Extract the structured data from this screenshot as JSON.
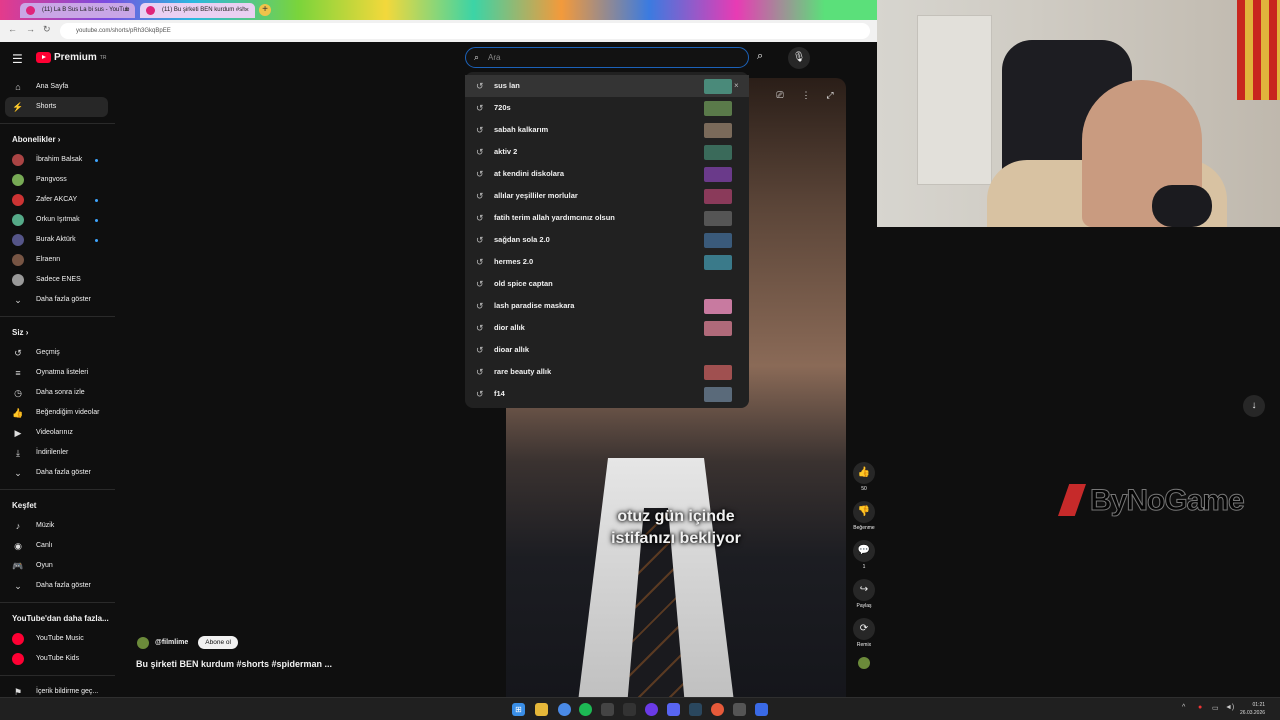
{
  "browser": {
    "tabs": [
      {
        "label": "(11) La B Sus La bi sus - YouTub"
      },
      {
        "label": "(11) Bu şirketi BEN kurdum #sh"
      }
    ],
    "tab_close": "×",
    "new_tab": "+",
    "url": "youtube.com/shorts/pRh3GkqBpEE"
  },
  "header": {
    "logo_text": "Premium",
    "logo_sup": "TR",
    "search_placeholder": "Ara"
  },
  "sidebar": {
    "main": [
      {
        "label": "Ana Sayfa",
        "icon": "home-icon"
      },
      {
        "label": "Shorts",
        "icon": "shorts-icon"
      }
    ],
    "subs_head": "Abonelikler",
    "subs": [
      {
        "label": "İbrahim Balsak"
      },
      {
        "label": "Pangvoss"
      },
      {
        "label": "Zafer AKCAY"
      },
      {
        "label": "Orkun Işıtmak"
      },
      {
        "label": "Burak Aktürk"
      },
      {
        "label": "Elraenn"
      },
      {
        "label": "Sadece ENES"
      }
    ],
    "more1": "Daha fazla göster",
    "you_head": "Siz",
    "you": [
      {
        "label": "Geçmiş",
        "icon": "history-icon"
      },
      {
        "label": "Oynatma listeleri",
        "icon": "playlist-icon"
      },
      {
        "label": "Daha sonra izle",
        "icon": "clock-icon"
      },
      {
        "label": "Beğendiğim videolar",
        "icon": "like-icon"
      },
      {
        "label": "Videolarınız",
        "icon": "video-icon"
      },
      {
        "label": "İndirilenler",
        "icon": "download-icon"
      }
    ],
    "more2": "Daha fazla göster",
    "explore_head": "Keşfet",
    "explore": [
      {
        "label": "Müzik",
        "icon": "music-icon"
      },
      {
        "label": "Canlı",
        "icon": "live-icon"
      },
      {
        "label": "Oyun",
        "icon": "gaming-icon"
      }
    ],
    "more3": "Daha fazla göster",
    "more_yt_head": "YouTube'dan daha fazla...",
    "more_yt": [
      {
        "label": "YouTube Music"
      },
      {
        "label": "YouTube Kids"
      }
    ],
    "report": "İçerik bildirme geç..."
  },
  "suggestions": [
    {
      "text": "sus lan",
      "thumb": "#4a8a7a"
    },
    {
      "text": "720s",
      "thumb": "#5a7a4a"
    },
    {
      "text": "sabah kalkarım",
      "thumb": "#7a6a5a"
    },
    {
      "text": "aktiv 2",
      "thumb": "#3a6a5a"
    },
    {
      "text": "at kendini diskolara",
      "thumb": "#6a3a8a"
    },
    {
      "text": "allılar yeşilliler morlular",
      "thumb": "#8a3a5a"
    },
    {
      "text": "fatih terim allah yardımcınız olsun",
      "thumb": "#555555"
    },
    {
      "text": "sağdan sola 2.0",
      "thumb": "#3a5a7a"
    },
    {
      "text": "hermes 2.0",
      "thumb": "#3a7a8a"
    },
    {
      "text": "old spice captan",
      "thumb": null
    },
    {
      "text": "lash paradise maskara",
      "thumb": "#c87aa0"
    },
    {
      "text": "dior allık",
      "thumb": "#b06a7a"
    },
    {
      "text": "dioar allık",
      "thumb": null
    },
    {
      "text": "rare beauty allık",
      "thumb": "#a05050"
    },
    {
      "text": "f14",
      "thumb": "#5a6a7a"
    }
  ],
  "remove_label": "×",
  "video": {
    "caption_line1": "otuz gün içinde",
    "caption_line2": "istifanızı bekliyor",
    "progress": 0.15,
    "likes": "50",
    "dislike_label": "Beğenme",
    "comments": "1",
    "share_label": "Paylaş",
    "remix_label": "Remix",
    "channel": "@filmlime",
    "subscribe_label": "Abone ol",
    "title": "Bu şirketi BEN kurdum #shorts #spiderman ..."
  },
  "overlay": {
    "brand": "ByNoGame"
  },
  "taskbar": {
    "time": "01:21",
    "date": "26.03.2026"
  },
  "colors": {
    "yt_red": "#ff0033",
    "focus_blue": "#1c62b9",
    "bg": "#0f0f0f"
  }
}
